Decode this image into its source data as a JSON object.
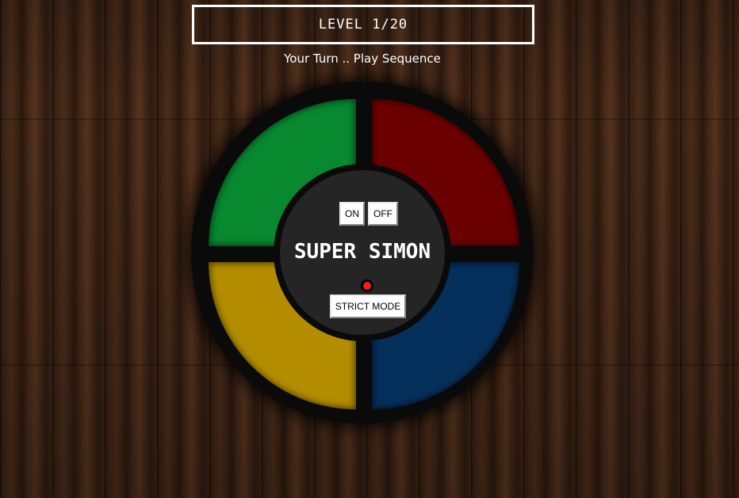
{
  "header": {
    "level_label": "LEVEL 1/20",
    "status": "Your Turn .. Play Sequence"
  },
  "game": {
    "title": "SUPER SIMON",
    "on_label": "ON",
    "off_label": "OFF",
    "strict_label": "STRICT MODE",
    "strict_indicator_on": true
  },
  "colors": {
    "green": "#08882f",
    "red": "#6b0000",
    "yellow": "#b38c00",
    "blue": "#06305c",
    "strict_led": "#ff1a1a"
  }
}
